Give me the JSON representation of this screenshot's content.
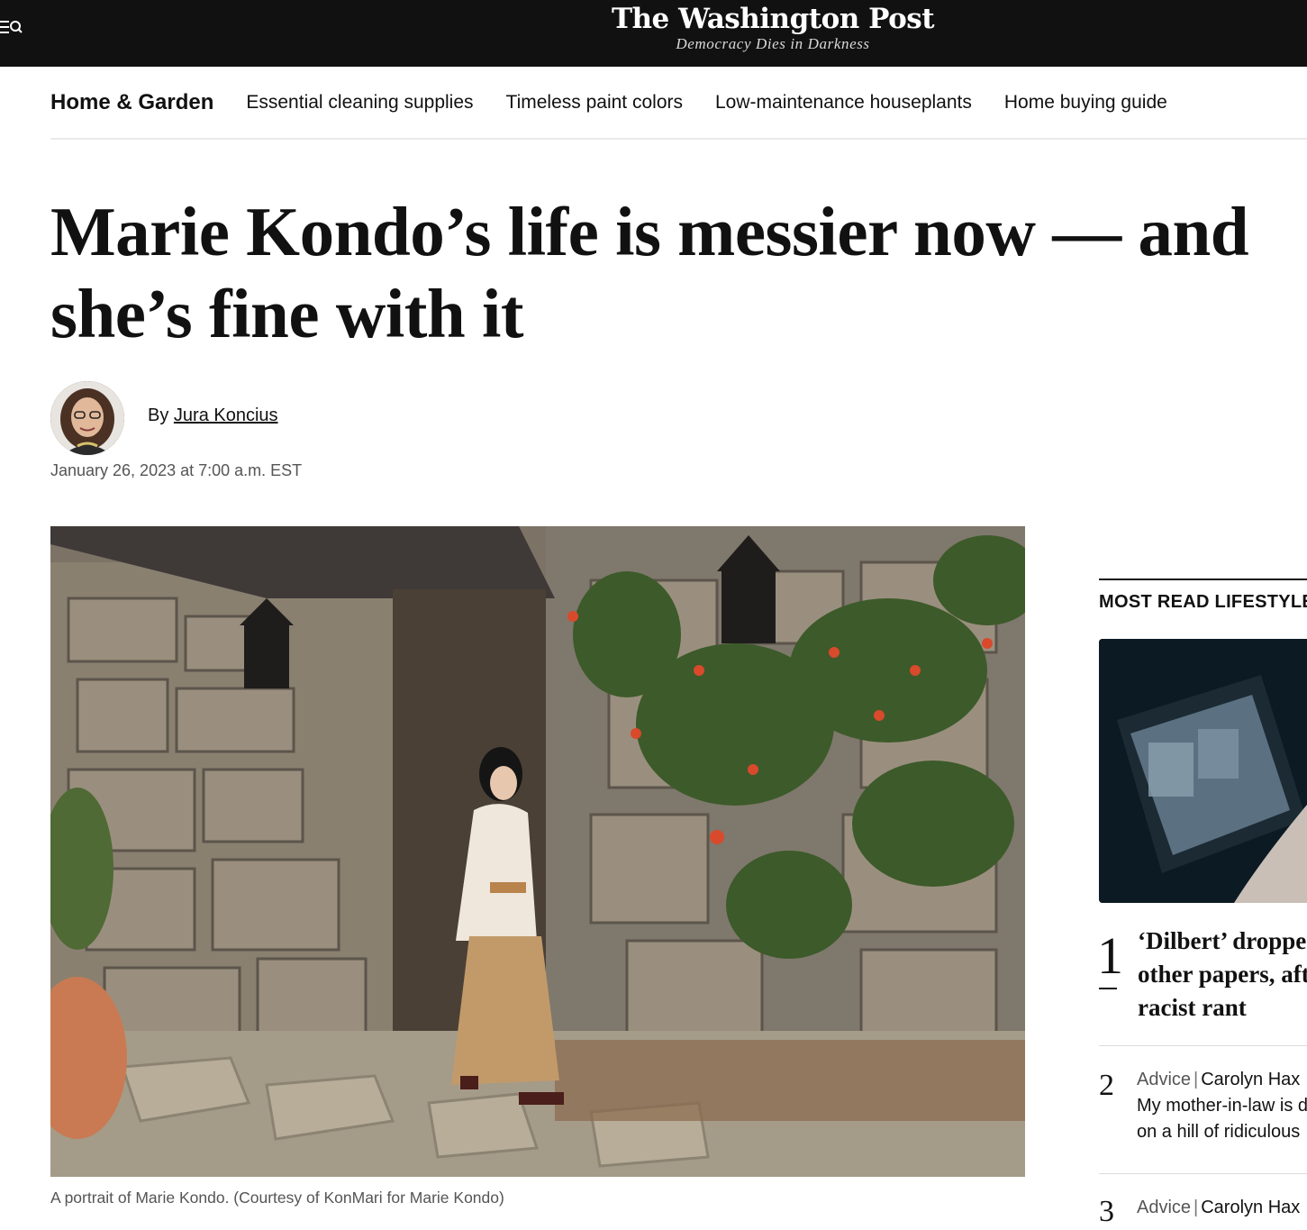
{
  "masthead": {
    "brand_name": "The Washington Post",
    "tagline": "Democracy Dies in Darkness",
    "menu_icon": "menu-search-icon"
  },
  "section_nav": {
    "section": "Home & Garden",
    "links": [
      "Essential cleaning supplies",
      "Timeless paint colors",
      "Low-maintenance houseplants",
      "Home buying guide"
    ]
  },
  "article": {
    "headline": "Marie Kondo’s life is messier now — and she’s fine with it",
    "byline_prefix": "By",
    "author": "Jura Koncius",
    "date": "January 26, 2023 at 7:00 a.m. EST",
    "caption": "A portrait of Marie Kondo. (Courtesy of KonMari for Marie Kondo)"
  },
  "sidebar": {
    "heading": "MOST READ LIFESTYLE",
    "stories": [
      {
        "rank": "1",
        "title": "‘Dilbert’ dropped by other papers, after racist rant"
      },
      {
        "rank": "2",
        "kicker": "Advice",
        "author": "Carolyn Hax",
        "title": "My mother-in-law is dying on a hill of ridiculous"
      },
      {
        "rank": "3",
        "kicker": "Advice",
        "author": "Carolyn Hax"
      }
    ]
  },
  "colors": {
    "masthead_bg": "#111111",
    "text": "#111111",
    "muted": "#555555"
  }
}
